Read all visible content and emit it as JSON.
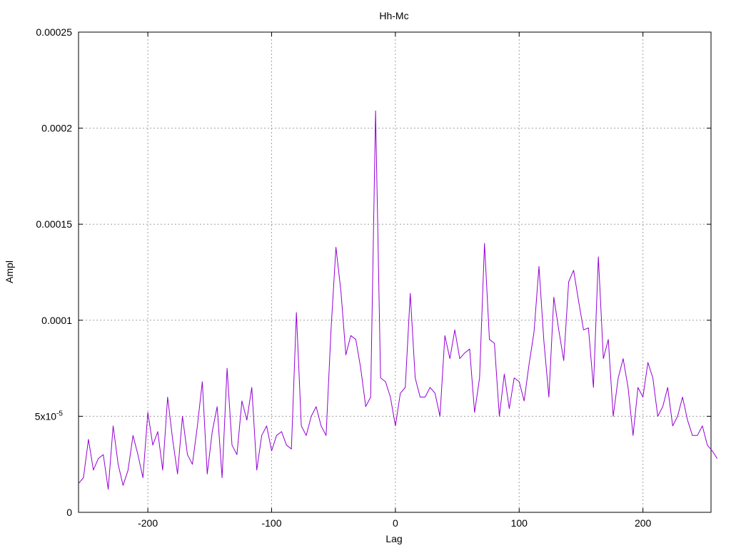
{
  "chart_data": {
    "type": "line",
    "title": "Hh-Mc",
    "xlabel": "Lag",
    "ylabel": "Ampl",
    "xlim": [
      -256,
      255
    ],
    "ylim": [
      0,
      0.00025
    ],
    "grid": true,
    "x_ticks": [
      {
        "value": -200,
        "label": "-200"
      },
      {
        "value": -100,
        "label": "-100"
      },
      {
        "value": 0,
        "label": "0"
      },
      {
        "value": 100,
        "label": "100"
      },
      {
        "value": 200,
        "label": "200"
      }
    ],
    "y_ticks": [
      {
        "value": 0,
        "label": "0"
      },
      {
        "value": 5e-05,
        "label": "5x10",
        "exp": "-5"
      },
      {
        "value": 0.0001,
        "label": "0.0001"
      },
      {
        "value": 0.00015,
        "label": "0.00015"
      },
      {
        "value": 0.0002,
        "label": "0.0002"
      },
      {
        "value": 0.00025,
        "label": "0.00025"
      }
    ],
    "series": [
      {
        "color": "#9400d3",
        "x_start": -256,
        "x_step": 4,
        "values": [
          1.5e-05,
          1.8e-05,
          3.8e-05,
          2.2e-05,
          2.8e-05,
          3e-05,
          1.2e-05,
          4.5e-05,
          2.5e-05,
          1.4e-05,
          2.2e-05,
          4e-05,
          3e-05,
          1.8e-05,
          5.2e-05,
          3.5e-05,
          4.2e-05,
          2.2e-05,
          6e-05,
          3.8e-05,
          2e-05,
          5e-05,
          3e-05,
          2.5e-05,
          4.5e-05,
          6.8e-05,
          2e-05,
          4.2e-05,
          5.5e-05,
          1.8e-05,
          7.5e-05,
          3.5e-05,
          3e-05,
          5.8e-05,
          4.8e-05,
          6.5e-05,
          2.2e-05,
          4e-05,
          4.5e-05,
          3.2e-05,
          4e-05,
          4.2e-05,
          3.5e-05,
          3.3e-05,
          0.000104,
          4.5e-05,
          4e-05,
          5e-05,
          5.5e-05,
          4.5e-05,
          4e-05,
          9.5e-05,
          0.000138,
          0.000115,
          8.2e-05,
          9.2e-05,
          9e-05,
          7.5e-05,
          5.5e-05,
          6e-05,
          0.000209,
          7e-05,
          6.8e-05,
          6e-05,
          4.5e-05,
          6.2e-05,
          6.5e-05,
          0.000114,
          7e-05,
          6e-05,
          6e-05,
          6.5e-05,
          6.2e-05,
          5e-05,
          9.2e-05,
          8e-05,
          9.5e-05,
          8e-05,
          8.3e-05,
          8.5e-05,
          5.2e-05,
          7e-05,
          0.00014,
          9e-05,
          8.8e-05,
          5e-05,
          7.2e-05,
          5.4e-05,
          7e-05,
          6.8e-05,
          5.8e-05,
          7.7e-05,
          9.4e-05,
          0.000128,
          8.9e-05,
          6e-05,
          0.000112,
          9.5e-05,
          7.9e-05,
          0.00012,
          0.000126,
          0.00011,
          9.5e-05,
          9.6e-05,
          6.5e-05,
          0.000133,
          8e-05,
          9e-05,
          5e-05,
          7e-05,
          8e-05,
          6.5e-05,
          4e-05,
          6.5e-05,
          6e-05,
          7.8e-05,
          7e-05,
          5e-05,
          5.5e-05,
          6.5e-05,
          4.5e-05,
          5e-05,
          6e-05,
          4.8e-05,
          4e-05,
          4e-05,
          4.5e-05,
          3.5e-05,
          3.2e-05,
          2.8e-05
        ]
      }
    ]
  }
}
